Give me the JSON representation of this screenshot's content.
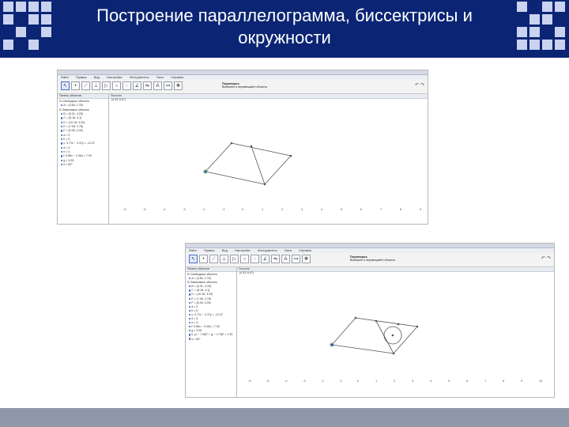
{
  "slide": {
    "title_line1": "Построение параллелограмма, биссектрисы и",
    "title_line2": "окружности"
  },
  "shots": [
    {
      "window_title": "GeoGebra",
      "menu": [
        "Файл",
        "Правка",
        "Вид",
        "Настройки",
        "Инструменты",
        "Окно",
        "Справка"
      ],
      "tool_name": "Перемещать",
      "tool_hint": "Выберите и перемещайте объекты",
      "algebra_title": "Панель объектов",
      "graphics_title": "Полотно",
      "coord_readout": "(4.33, 8.47)",
      "algebra_items": [
        "Свободные объекты",
        "A = (3.68, 1.78)",
        "Зависимые объекты",
        "B = (5.31, 4.25)",
        "C = (8.18, 4.1)",
        "D = (10.18, 3.33)",
        "E = (7.08, 3.78)",
        "F = (6.35, 4.09)",
        "a = 3",
        "b = 5",
        "c: 3.71x − 2.37y = -12.37",
        "d = 3",
        "e = 4",
        "f: 0.86x − 0.49y = 7.93",
        "g = 3.05",
        "α = 80°"
      ],
      "axis_ticks": [
        "-6",
        "-5",
        "-4",
        "-3",
        "-2",
        "-1",
        "0",
        "1",
        "2",
        "3",
        "4",
        "5",
        "6",
        "7",
        "8",
        "9"
      ]
    },
    {
      "window_title": "GeoGebra",
      "menu": [
        "Файл",
        "Правка",
        "Вид",
        "Настройки",
        "Инструменты",
        "Окно",
        "Справка"
      ],
      "tool_name": "Перемещать",
      "tool_hint": "Выберите и перемещайте объекты",
      "algebra_title": "Панель объектов",
      "graphics_title": "Полотно",
      "coord_readout": "(4.33, 8.47)",
      "algebra_items": [
        "Свободные объекты",
        "A = (3.68, 1.78)",
        "Зависимые объекты",
        "B = (5.31, 4.25)",
        "C = (8.18, 4.1)",
        "D = (10.18, 3.33)",
        "E = (7.08, 3.78)",
        "F = (6.35, 4.09)",
        "a = 3",
        "b = 5",
        "c: 3.71x − 2.37y = -12.37",
        "d = 3",
        "e = 4",
        "f: 0.86x − 0.49y = 7.93",
        "g = 3.05",
        "h: (x − 7.08)² + (y − 2.78)² = 1.25",
        "α = 80°"
      ],
      "axis_ticks": [
        "-6",
        "-5",
        "-4",
        "-3",
        "-2",
        "-1",
        "0",
        "1",
        "2",
        "3",
        "4",
        "5",
        "6",
        "7",
        "8",
        "9",
        "10"
      ]
    }
  ],
  "colors": {
    "header": "#0b2574",
    "squares": "#c9d2ef",
    "footer": "#8f98a8",
    "point_blue": "#1a3cb3",
    "point_selected": "#6fae6f"
  }
}
